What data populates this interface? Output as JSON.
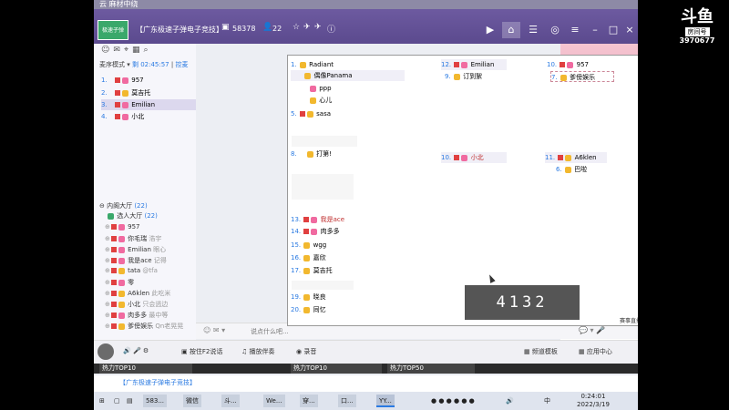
{
  "window": {
    "top_strip": "云 麻材中绕",
    "channel_title": "【广东极速子弹电子竞技】",
    "channel_id": "58378",
    "user_count": "22",
    "logo_text": "极速子弹"
  },
  "left_panel": {
    "mode_label": "麦序模式",
    "mode_time": "剩 02:45:57",
    "mode_extra": "控麦",
    "queue": [
      {
        "num": "1.",
        "name": "957"
      },
      {
        "num": "2.",
        "name": "莫吉托"
      },
      {
        "num": "3.",
        "name": "Emilian"
      },
      {
        "num": "4.",
        "name": "小北"
      }
    ],
    "tree_section_1": "内阁大厅",
    "tree_section_1_count": "(22)",
    "tree_section_2": "选人大厅",
    "tree_section_2_count": "(22)",
    "members": [
      {
        "name": "957"
      },
      {
        "name": "你毛瑞",
        "note": "浩宇"
      },
      {
        "name": "Emilian",
        "note": "眼心"
      },
      {
        "name": "我是ace",
        "note": "记得"
      },
      {
        "name": "tata",
        "note": "@tfa"
      },
      {
        "name": "零"
      },
      {
        "name": "A6klen",
        "note": "此吃米"
      },
      {
        "name": "小北",
        "note": "只会逃边"
      },
      {
        "name": "肉多多",
        "note": "最中等"
      },
      {
        "name": "爹傍娱乐",
        "note": "Qn老晃晃"
      }
    ]
  },
  "modal": {
    "close_label": "×",
    "col1": [
      {
        "num": "1.",
        "name": "Radiant"
      },
      {
        "num": "",
        "name": "偶像Panama"
      },
      {
        "num": "",
        "name": "ppp"
      },
      {
        "num": "",
        "name": "心儿"
      },
      {
        "num": "5.",
        "name": "sasa"
      },
      {
        "num": "8.",
        "name": "打第!"
      },
      {
        "num": "13.",
        "name": "我是ace"
      },
      {
        "num": "14.",
        "name": "肉多多"
      },
      {
        "num": "15.",
        "name": "wgg"
      },
      {
        "num": "16.",
        "name": "嘉欣"
      },
      {
        "num": "17.",
        "name": "莫吉托"
      },
      {
        "num": "19.",
        "name": "晓良"
      },
      {
        "num": "20.",
        "name": "同忆"
      }
    ],
    "col2": [
      {
        "num": "12.",
        "name": "Emilian"
      },
      {
        "num": "9.",
        "name": "订到絮"
      },
      {
        "num": "10.",
        "name": "小北"
      }
    ],
    "col3": [
      {
        "num": "10.",
        "name": "957"
      },
      {
        "num": "7.",
        "name": "爹傍娱乐"
      },
      {
        "num": "11.",
        "name": "A6klen"
      },
      {
        "num": "6.",
        "name": "巴啦"
      }
    ],
    "score": "4132",
    "watermark": "赛事直播"
  },
  "chat": {
    "placeholder": "说点什么吧..."
  },
  "bottom_bar": {
    "mic_label": "按住F2说话",
    "play_label": "播放伴奏",
    "record_label": "录音",
    "template_label": "频道模板",
    "app_center_label": "应用中心"
  },
  "thumbnails": [
    {
      "label": "热力TOP10"
    },
    {
      "label": "热力TOP10"
    },
    {
      "label": "热力TOP50"
    }
  ],
  "subtitle": "【广东极速子弹电子竞技】",
  "taskbar": {
    "apps": [
      {
        "label": "583..."
      },
      {
        "label": "微信"
      },
      {
        "label": "斗..."
      },
      {
        "label": "We..."
      },
      {
        "label": "穿..."
      },
      {
        "label": "口..."
      },
      {
        "label": "YY..."
      }
    ],
    "lang": "中",
    "time": "0:24:01",
    "date": "2022/3/19"
  },
  "douyu": {
    "brand": "斗鱼",
    "room_label": "房间号",
    "room_number": "3970677"
  },
  "colors": {
    "title_bar": "#5b4a8e",
    "accent_blue": "#2a7ae2",
    "badge_red": "#e04040"
  }
}
